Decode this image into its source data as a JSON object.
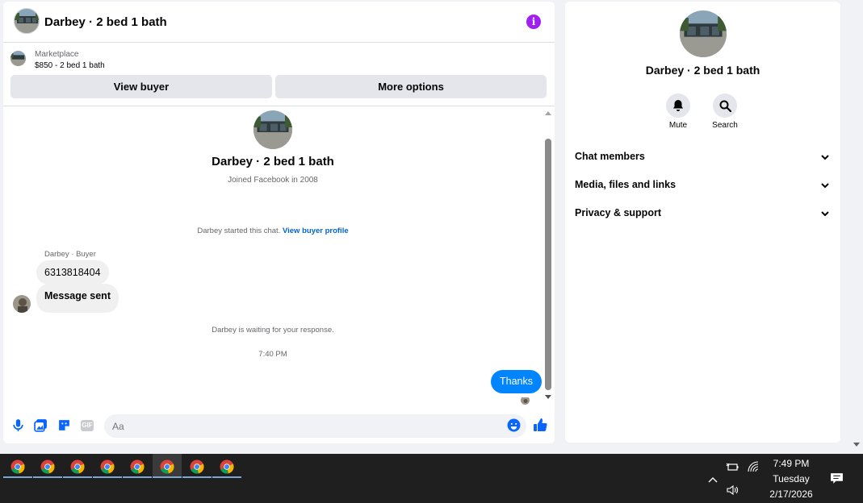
{
  "chat": {
    "title": "Darbey · 2 bed 1 bath",
    "listing": {
      "source": "Marketplace",
      "price_title": "$850 - 2 bed 1 bath"
    },
    "buttons": {
      "view_buyer": "View buyer",
      "more_options": "More options"
    },
    "profile": {
      "name": "Darbey · 2 bed 1 bath",
      "joined": "Joined Facebook in 2008"
    },
    "started_text": "Darbey started this chat.",
    "started_link": "View buyer profile",
    "sender_label": "Darbey · Buyer",
    "messages_in": [
      "6313818404",
      "Message sent"
    ],
    "waiting_text": "Darbey is waiting for your response.",
    "timestamp": "7:40 PM",
    "message_out": "Thanks",
    "composer_placeholder": "Aa"
  },
  "info_panel": {
    "name": "Darbey · 2 bed 1 bath",
    "actions": {
      "mute": "Mute",
      "search": "Search"
    },
    "sections": [
      "Chat members",
      "Media, files and links",
      "Privacy & support"
    ]
  },
  "taskbar": {
    "apps": [
      "chrome-icon",
      "chrome-icon",
      "chrome-icon",
      "chrome-icon",
      "chrome-icon",
      "chrome-icon",
      "chrome-icon",
      "chrome-icon"
    ],
    "active_app_index": 5,
    "time": "7:49 PM",
    "day": "Tuesday",
    "date": "2/17/2026"
  },
  "colors": {
    "accent": "#0084ff",
    "link": "#0064d1",
    "info_icon": "#a020f0",
    "taskbar": "#1f1f1f"
  }
}
